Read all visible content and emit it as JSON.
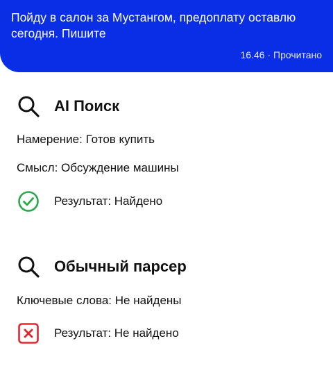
{
  "message": {
    "text": "Пойду в салон за Мустангом, предоплату оставлю сегодня. Пишите",
    "time": "16.46",
    "separator": "·",
    "status": "Прочитано"
  },
  "ai_search": {
    "icon": "search-icon",
    "title": "AI Поиск",
    "intent": "Намерение: Готов купить",
    "meaning": "Смысл: Обсуждение машины",
    "result_icon": "check-circle-icon",
    "result": "Результат: Найдено"
  },
  "parser": {
    "icon": "search-icon",
    "title": "Обычный парсер",
    "keywords": "Ключевые слова: Не найдены",
    "result_icon": "x-square-icon",
    "result": "Результат: Не найдено"
  },
  "colors": {
    "bubble_bg": "#0a2ee6",
    "success": "#2aa84a",
    "error": "#e0262f"
  }
}
